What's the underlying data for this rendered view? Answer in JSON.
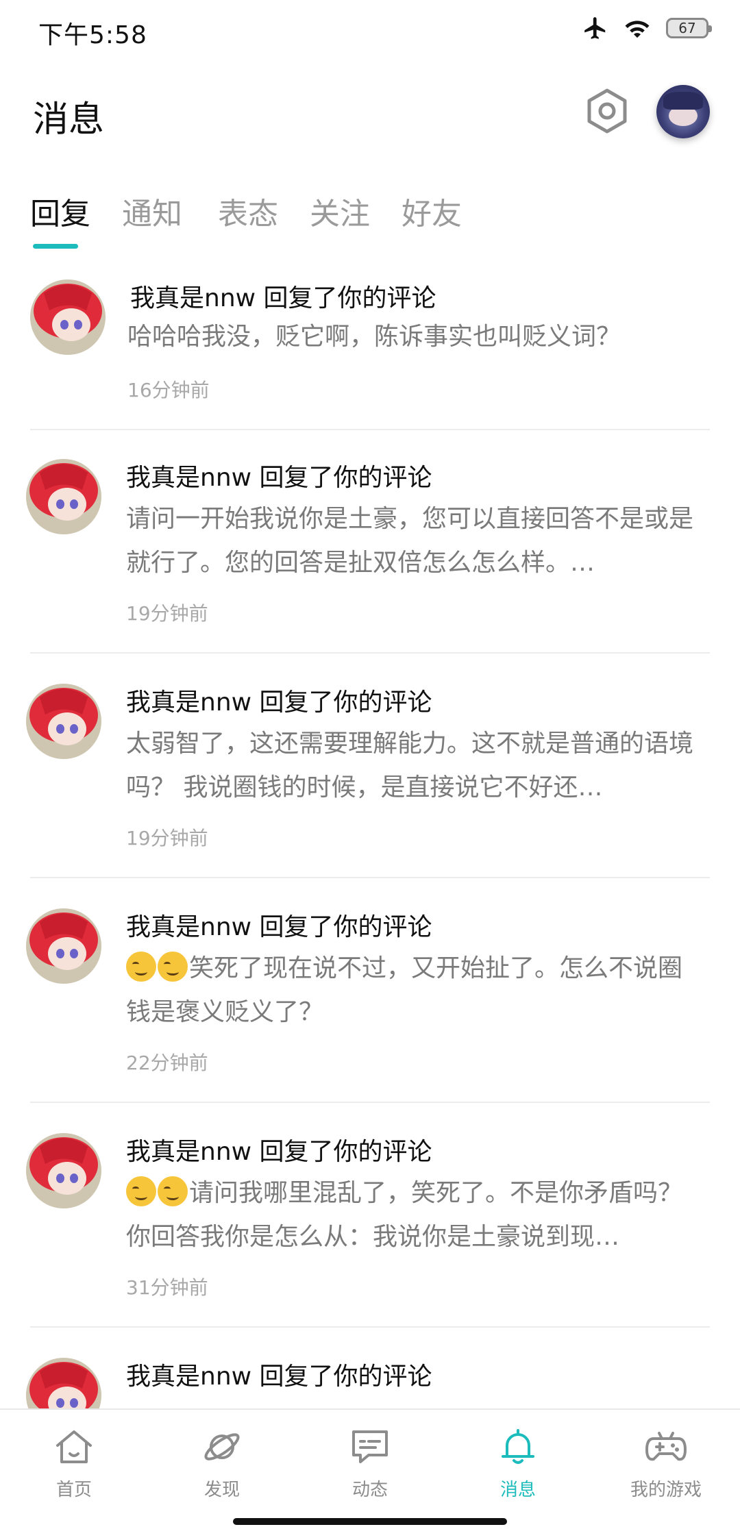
{
  "status_bar": {
    "time": "下午5:58",
    "battery": "67"
  },
  "header": {
    "title": "消息"
  },
  "tabs": [
    {
      "label": "回复",
      "active": true
    },
    {
      "label": "通知",
      "active": false
    },
    {
      "label": "表态",
      "active": false
    },
    {
      "label": "关注",
      "active": false
    },
    {
      "label": "好友",
      "active": false
    }
  ],
  "messages": [
    {
      "title": "我真是nnw 回复了你的评论",
      "body": "哈哈哈我没，贬它啊，陈诉事实也叫贬义词？",
      "time": "16分钟前"
    },
    {
      "title": "我真是nnw 回复了你的评论",
      "body": "请问一开始我说你是土豪，您可以直接回答不是或是就行了。您的回答是扯双倍怎么怎么样。…",
      "time": "19分钟前"
    },
    {
      "title": "我真是nnw 回复了你的评论",
      "body": "太弱智了，这还需要理解能力。这不就是普通的语境吗？  我说圈钱的时候，是直接说它不好还…",
      "time": "19分钟前"
    },
    {
      "title": "我真是nnw 回复了你的评论",
      "body": "笑死了现在说不过，又开始扯了。怎么不说圈钱是褒义贬义了？",
      "time": "22分钟前",
      "emoji_prefix": 2
    },
    {
      "title": "我真是nnw 回复了你的评论",
      "body": "请问我哪里混乱了，笑死了。不是你矛盾吗？你回答我你是怎么从：我说你是土豪说到现…",
      "time": "31分钟前",
      "emoji_prefix": 2
    },
    {
      "title": "我真是nnw 回复了你的评论",
      "body": "",
      "time": ""
    }
  ],
  "bottom_nav": [
    {
      "label": "首页",
      "icon": "home-icon"
    },
    {
      "label": "发现",
      "icon": "planet-icon"
    },
    {
      "label": "动态",
      "icon": "chat-icon"
    },
    {
      "label": "消息",
      "icon": "bell-icon",
      "active": true
    },
    {
      "label": "我的游戏",
      "icon": "gamepad-icon"
    }
  ],
  "colors": {
    "accent": "#1cbcbc",
    "muted_text": "#7a7a7a",
    "time_text": "#a8a8a8"
  }
}
